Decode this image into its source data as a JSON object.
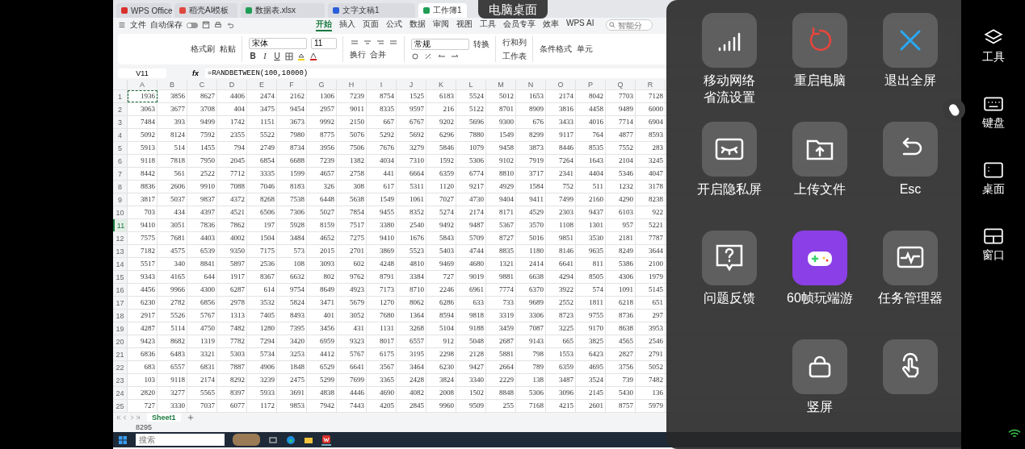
{
  "app_tabs": [
    {
      "label": "WPS Office",
      "selected": false
    },
    {
      "label": "稻壳AI模板",
      "selected": false
    },
    {
      "label": "数据表.xlsx",
      "selected": false
    },
    {
      "label": "文字文稿1",
      "selected": false
    },
    {
      "label": "工作簿1",
      "selected": true
    }
  ],
  "menu": {
    "file": "文件",
    "autosave": {
      "label": "自动保存",
      "on": false
    },
    "tabs": [
      {
        "label": "开始",
        "selected": true
      },
      {
        "label": "插入",
        "selected": false
      },
      {
        "label": "页面",
        "selected": false
      },
      {
        "label": "公式",
        "selected": false
      },
      {
        "label": "数据",
        "selected": false
      },
      {
        "label": "审阅",
        "selected": false
      },
      {
        "label": "视图",
        "selected": false
      },
      {
        "label": "工具",
        "selected": false
      },
      {
        "label": "会员专享",
        "selected": false
      },
      {
        "label": "效率",
        "selected": false
      },
      {
        "label": "WPS AI",
        "selected": false
      }
    ],
    "search": {
      "placeholder": "智能分"
    }
  },
  "ribbon": {
    "clipboard": [
      "格式刷",
      "粘贴"
    ],
    "font": "宋体",
    "size": "11",
    "font_styles": [
      "B",
      "I",
      "U"
    ],
    "wrap": [
      "换行",
      "合并"
    ],
    "number_format": "常规",
    "convert": "转换",
    "rows_cols": "行和列",
    "worksheet": "工作表",
    "conditional": "条件格式",
    "cell": "单元"
  },
  "formula_bar": {
    "cell": "V11",
    "fx": "fx",
    "formula": "=RANDBETWEEN(100,10000)"
  },
  "table": {
    "columns": [
      "A",
      "B",
      "C",
      "D",
      "E",
      "F",
      "G",
      "H",
      "I",
      "J",
      "K",
      "L",
      "M",
      "N",
      "O",
      "P",
      "Q",
      "R"
    ],
    "rows": [
      {
        "n": "1",
        "selected": false,
        "cells": [
          "1936",
          "3856",
          "8627",
          "4406",
          "2474",
          "2162",
          "1306",
          "7239",
          "8754",
          "1525",
          "6183",
          "5524",
          "5012",
          "1653",
          "2174",
          "8042",
          "7703",
          "7128"
        ]
      },
      {
        "n": "2",
        "selected": false,
        "cells": [
          "3063",
          "3677",
          "3708",
          "404",
          "3475",
          "9454",
          "2957",
          "9011",
          "8335",
          "9597",
          "216",
          "5122",
          "8701",
          "8909",
          "3816",
          "4458",
          "9489",
          "6000"
        ]
      },
      {
        "n": "3",
        "selected": false,
        "cells": [
          "7484",
          "393",
          "9499",
          "1742",
          "1151",
          "3673",
          "9992",
          "2150",
          "667",
          "6767",
          "9202",
          "5696",
          "9300",
          "676",
          "3433",
          "4016",
          "7714",
          "6904"
        ]
      },
      {
        "n": "4",
        "selected": false,
        "cells": [
          "5092",
          "8124",
          "7592",
          "2355",
          "5522",
          "7980",
          "8775",
          "5076",
          "5292",
          "5692",
          "6296",
          "7880",
          "1549",
          "8299",
          "9117",
          "764",
          "4877",
          "8593"
        ]
      },
      {
        "n": "5",
        "selected": false,
        "cells": [
          "5913",
          "514",
          "1455",
          "794",
          "2749",
          "8734",
          "3956",
          "7506",
          "7676",
          "3279",
          "5846",
          "1079",
          "9458",
          "3873",
          "8446",
          "8535",
          "7552",
          "283"
        ]
      },
      {
        "n": "6",
        "selected": false,
        "cells": [
          "9118",
          "7818",
          "7950",
          "2045",
          "6854",
          "6688",
          "7239",
          "1382",
          "4034",
          "7310",
          "1592",
          "5306",
          "9102",
          "7919",
          "7264",
          "1643",
          "2104",
          "3245"
        ]
      },
      {
        "n": "7",
        "selected": false,
        "cells": [
          "8442",
          "561",
          "2522",
          "7712",
          "3335",
          "1599",
          "4657",
          "2758",
          "441",
          "6664",
          "6359",
          "6774",
          "8810",
          "3717",
          "2341",
          "4404",
          "5346",
          "4047"
        ]
      },
      {
        "n": "8",
        "selected": false,
        "cells": [
          "8836",
          "2606",
          "9910",
          "7088",
          "7046",
          "8183",
          "326",
          "308",
          "617",
          "5311",
          "1120",
          "9217",
          "4929",
          "1584",
          "752",
          "511",
          "1232",
          "3178"
        ]
      },
      {
        "n": "9",
        "selected": false,
        "cells": [
          "3817",
          "5037",
          "9837",
          "4372",
          "8268",
          "7538",
          "6448",
          "5638",
          "1549",
          "1061",
          "7027",
          "4730",
          "9404",
          "9411",
          "7499",
          "2160",
          "4290",
          "8238"
        ]
      },
      {
        "n": "10",
        "selected": false,
        "cells": [
          "703",
          "434",
          "4397",
          "4521",
          "6506",
          "7306",
          "5027",
          "7854",
          "9455",
          "8352",
          "5274",
          "2174",
          "8171",
          "4529",
          "2303",
          "9437",
          "6103",
          "922"
        ]
      },
      {
        "n": "11",
        "selected": true,
        "cells": [
          "9410",
          "3051",
          "7836",
          "7862",
          "197",
          "5928",
          "8159",
          "7517",
          "3380",
          "2540",
          "9492",
          "9487",
          "5367",
          "3570",
          "1108",
          "1301",
          "957",
          "5221"
        ]
      },
      {
        "n": "12",
        "selected": false,
        "cells": [
          "7575",
          "7681",
          "4403",
          "4002",
          "1504",
          "3484",
          "4652",
          "7275",
          "9410",
          "1676",
          "5843",
          "5709",
          "8727",
          "5016",
          "9851",
          "3530",
          "2181",
          "7787"
        ]
      },
      {
        "n": "13",
        "selected": false,
        "cells": [
          "7182",
          "4575",
          "6539",
          "9350",
          "7175",
          "573",
          "2015",
          "2701",
          "3869",
          "5523",
          "5403",
          "4744",
          "8835",
          "1180",
          "8146",
          "9635",
          "8249",
          "3644"
        ]
      },
      {
        "n": "14",
        "selected": false,
        "cells": [
          "5517",
          "340",
          "8841",
          "5897",
          "2536",
          "108",
          "3093",
          "602",
          "4248",
          "4810",
          "9469",
          "4680",
          "1321",
          "2414",
          "6641",
          "811",
          "5386",
          "2100"
        ]
      },
      {
        "n": "15",
        "selected": false,
        "cells": [
          "9343",
          "4165",
          "644",
          "1917",
          "8367",
          "6632",
          "802",
          "9762",
          "8791",
          "3384",
          "727",
          "9019",
          "9881",
          "6638",
          "4294",
          "8505",
          "4306",
          "1979"
        ]
      },
      {
        "n": "16",
        "selected": false,
        "cells": [
          "4456",
          "9966",
          "4300",
          "6287",
          "614",
          "9754",
          "8649",
          "4923",
          "7173",
          "8710",
          "2246",
          "6961",
          "7774",
          "6370",
          "3922",
          "574",
          "1091",
          "5145"
        ]
      },
      {
        "n": "17",
        "selected": false,
        "cells": [
          "6230",
          "2782",
          "6856",
          "2978",
          "3532",
          "5824",
          "3471",
          "5679",
          "1270",
          "8062",
          "6286",
          "633",
          "733",
          "9689",
          "2552",
          "1811",
          "6218",
          "651"
        ]
      },
      {
        "n": "18",
        "selected": false,
        "cells": [
          "2917",
          "5526",
          "5767",
          "1313",
          "7405",
          "8493",
          "401",
          "3052",
          "7680",
          "1364",
          "8594",
          "9818",
          "3319",
          "3306",
          "8723",
          "9755",
          "8736",
          "297"
        ]
      },
      {
        "n": "19",
        "selected": false,
        "cells": [
          "4287",
          "5114",
          "4750",
          "7482",
          "1280",
          "7395",
          "3456",
          "431",
          "1131",
          "3268",
          "5104",
          "9188",
          "3459",
          "7087",
          "3225",
          "9170",
          "8638",
          "3953"
        ]
      },
      {
        "n": "20",
        "selected": false,
        "cells": [
          "9423",
          "8682",
          "1319",
          "7782",
          "7294",
          "3420",
          "6959",
          "9323",
          "8017",
          "6557",
          "912",
          "5048",
          "2687",
          "9143",
          "665",
          "3825",
          "4565",
          "2546"
        ]
      },
      {
        "n": "21",
        "selected": false,
        "cells": [
          "6836",
          "6483",
          "3321",
          "5303",
          "5734",
          "3253",
          "4412",
          "5767",
          "6175",
          "3195",
          "2298",
          "2128",
          "5881",
          "798",
          "1553",
          "6423",
          "2827",
          "2791"
        ]
      },
      {
        "n": "22",
        "selected": false,
        "cells": [
          "683",
          "6557",
          "6831",
          "7887",
          "4906",
          "1848",
          "6529",
          "6641",
          "3567",
          "3464",
          "6230",
          "9427",
          "2664",
          "789",
          "6359",
          "4695",
          "3756",
          "5052"
        ]
      },
      {
        "n": "23",
        "selected": false,
        "cells": [
          "103",
          "9118",
          "2174",
          "8292",
          "3239",
          "2475",
          "5299",
          "7699",
          "3365",
          "2428",
          "3824",
          "3340",
          "2229",
          "138",
          "3487",
          "3524",
          "739",
          "7482"
        ]
      },
      {
        "n": "24",
        "selected": false,
        "cells": [
          "2820",
          "3277",
          "5565",
          "8397",
          "5933",
          "3691",
          "4838",
          "4446",
          "4690",
          "4082",
          "2008",
          "1502",
          "8848",
          "5306",
          "3096",
          "2145",
          "5430",
          "136"
        ]
      },
      {
        "n": "25",
        "selected": false,
        "cells": [
          "727",
          "3330",
          "7037",
          "6077",
          "1172",
          "9853",
          "7942",
          "7443",
          "4205",
          "2845",
          "9960",
          "9509",
          "255",
          "7168",
          "4215",
          "2601",
          "8757",
          "5979"
        ]
      }
    ]
  },
  "sheet_tabs": [
    {
      "label": "Sheet1",
      "selected": true
    }
  ],
  "status_bar": {
    "value": "8295"
  },
  "taskbar": {
    "search": {
      "placeholder": "搜索"
    }
  },
  "remote_title": "电脑桌面",
  "overlay": {
    "items": [
      {
        "kind": "signal",
        "label": "移动网络省流设置"
      },
      {
        "kind": "restart",
        "label": "重启电脑"
      },
      {
        "kind": "exit",
        "label": "退出全屏"
      },
      {
        "kind": "privacy",
        "label": "开启隐私屏"
      },
      {
        "kind": "upload",
        "label": "上传文件"
      },
      {
        "kind": "esc",
        "label": "Esc"
      },
      {
        "kind": "feedback",
        "label": "问题反馈"
      },
      {
        "kind": "gamepad",
        "label": "60帧玩端游"
      },
      {
        "kind": "monitor",
        "label": "任务管理器"
      },
      {
        "kind": "rotate",
        "label": "竖屏"
      },
      {
        "kind": "touch"
      }
    ]
  },
  "sidebar": [
    {
      "kind": "tools",
      "label": "工具"
    },
    {
      "kind": "keyboard",
      "label": "键盘"
    },
    {
      "kind": "desktop",
      "label": "桌面"
    },
    {
      "kind": "window",
      "label": "窗口"
    }
  ]
}
